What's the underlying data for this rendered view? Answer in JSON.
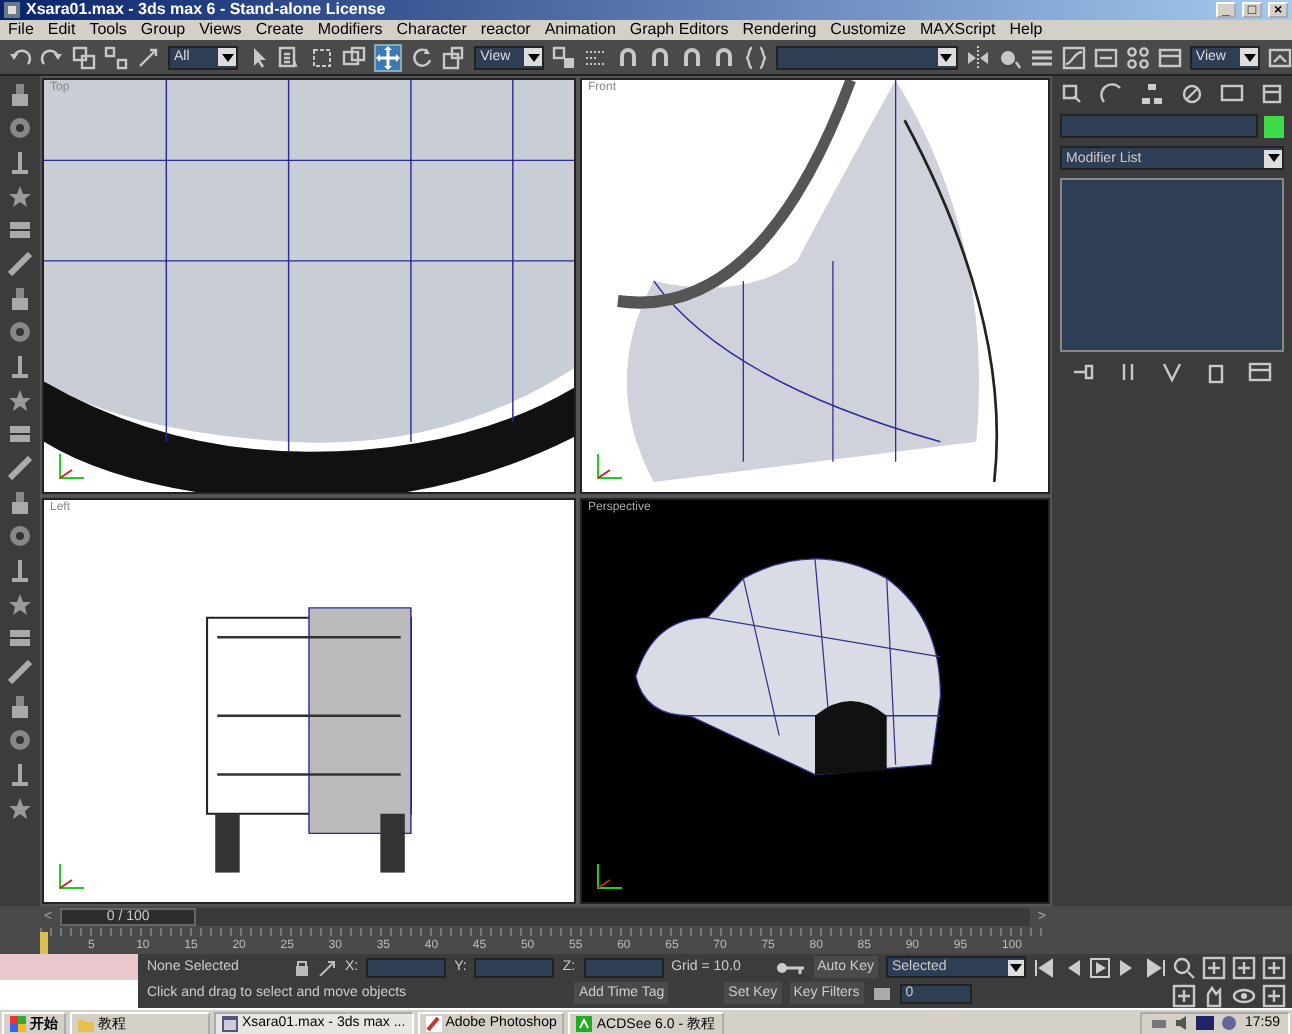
{
  "window": {
    "title": "Xsara01.max - 3ds max 6 - Stand-alone License"
  },
  "window_buttons": [
    "_",
    "□",
    "×"
  ],
  "menu": [
    "File",
    "Edit",
    "Tools",
    "Group",
    "Views",
    "Create",
    "Modifiers",
    "Character",
    "reactor",
    "Animation",
    "Graph Editors",
    "Rendering",
    "Customize",
    "MAXScript",
    "Help"
  ],
  "toolbar": [
    {
      "kind": "tool",
      "selected": false
    },
    {
      "kind": "tool",
      "selected": false
    },
    {
      "kind": "tool",
      "selected": false
    },
    {
      "kind": "tool",
      "selected": false
    },
    {
      "kind": "tool",
      "selected": false
    },
    {
      "kind": "dropdown",
      "value": "All"
    },
    {
      "kind": "tool",
      "selected": false
    },
    {
      "kind": "tool",
      "selected": false
    },
    {
      "kind": "tool",
      "selected": false
    },
    {
      "kind": "tool",
      "selected": false
    },
    {
      "kind": "tool",
      "selected": true
    },
    {
      "kind": "tool",
      "selected": false
    },
    {
      "kind": "tool",
      "selected": false
    },
    {
      "kind": "dropdown",
      "value": "View"
    },
    {
      "kind": "tool",
      "selected": false
    },
    {
      "kind": "tool",
      "selected": false
    },
    {
      "kind": "tool",
      "selected": false
    },
    {
      "kind": "tool",
      "selected": false
    },
    {
      "kind": "tool",
      "selected": false
    },
    {
      "kind": "tool",
      "selected": false
    },
    {
      "kind": "tool",
      "selected": false
    },
    {
      "kind": "dropdown"
    },
    {
      "kind": "tool",
      "selected": false
    },
    {
      "kind": "tool",
      "selected": false
    },
    {
      "kind": "tool",
      "selected": false
    },
    {
      "kind": "tool",
      "selected": false
    },
    {
      "kind": "tool",
      "selected": false
    },
    {
      "kind": "tool",
      "selected": false
    },
    {
      "kind": "tool",
      "selected": false
    },
    {
      "kind": "dropdown",
      "value": "View"
    },
    {
      "kind": "tool",
      "selected": false
    }
  ],
  "viewports": [
    {
      "label": "Top",
      "kind": "blueprint"
    },
    {
      "label": "Front",
      "kind": "blueprint"
    },
    {
      "label": "Left",
      "kind": "blueprint"
    },
    {
      "label": "Perspective",
      "kind": "shaded"
    }
  ],
  "command_panel": {
    "modifier_list": "Modifier List"
  },
  "time_slider": {
    "label": "0 / 100",
    "level": 0,
    "prev": "<",
    "next": ">"
  },
  "track_ticks": [
    "5",
    "10",
    "15",
    "20",
    "25",
    "30",
    "35",
    "40",
    "45",
    "50",
    "55",
    "60",
    "65",
    "70",
    "75",
    "80",
    "85",
    "90",
    "95",
    "100"
  ],
  "status": {
    "selection": "None Selected",
    "prompt": "Click and drag to select and move objects",
    "coords": [
      {
        "axis": "X:"
      },
      {
        "axis": "Y:"
      },
      {
        "axis": "Z:"
      }
    ],
    "grid": "Grid = 10.0",
    "add_time_tag": "Add Time Tag",
    "auto_key": "Auto Key",
    "key_mode": "Selected",
    "set_key": "Set Key",
    "key_filters": "Key Filters",
    "frame": "0"
  },
  "taskbar": {
    "start": "开始",
    "items": [
      {
        "label": "教程",
        "selected": false
      },
      {
        "label": "Xsara01.max - 3ds max ...",
        "selected": true
      },
      {
        "label": "Adobe Photoshop",
        "selected": false
      },
      {
        "label": "ACDSee 6.0 - 教程",
        "selected": false
      }
    ],
    "clock": "17:59"
  }
}
